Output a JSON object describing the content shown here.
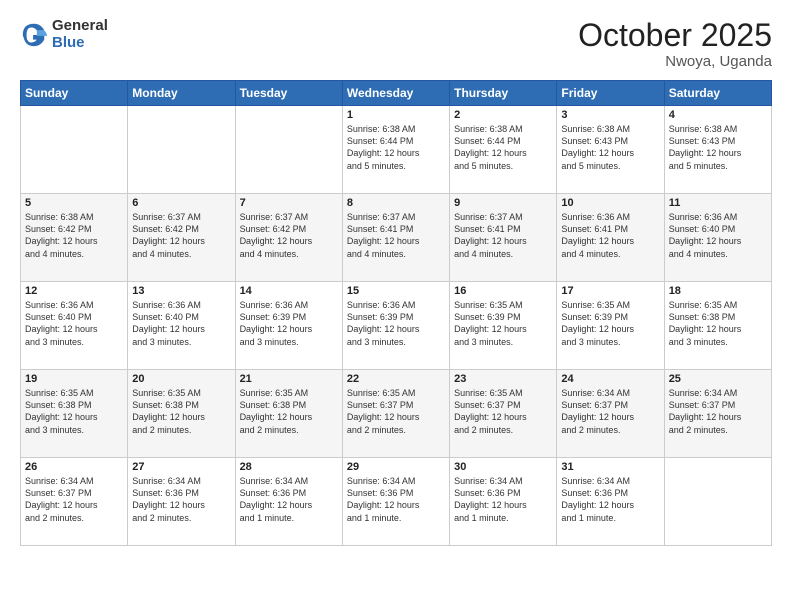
{
  "logo": {
    "general": "General",
    "blue": "Blue"
  },
  "header": {
    "month": "October 2025",
    "location": "Nwoya, Uganda"
  },
  "days_of_week": [
    "Sunday",
    "Monday",
    "Tuesday",
    "Wednesday",
    "Thursday",
    "Friday",
    "Saturday"
  ],
  "weeks": [
    [
      {
        "day": "",
        "info": ""
      },
      {
        "day": "",
        "info": ""
      },
      {
        "day": "",
        "info": ""
      },
      {
        "day": "1",
        "info": "Sunrise: 6:38 AM\nSunset: 6:44 PM\nDaylight: 12 hours\nand 5 minutes."
      },
      {
        "day": "2",
        "info": "Sunrise: 6:38 AM\nSunset: 6:44 PM\nDaylight: 12 hours\nand 5 minutes."
      },
      {
        "day": "3",
        "info": "Sunrise: 6:38 AM\nSunset: 6:43 PM\nDaylight: 12 hours\nand 5 minutes."
      },
      {
        "day": "4",
        "info": "Sunrise: 6:38 AM\nSunset: 6:43 PM\nDaylight: 12 hours\nand 5 minutes."
      }
    ],
    [
      {
        "day": "5",
        "info": "Sunrise: 6:38 AM\nSunset: 6:42 PM\nDaylight: 12 hours\nand 4 minutes."
      },
      {
        "day": "6",
        "info": "Sunrise: 6:37 AM\nSunset: 6:42 PM\nDaylight: 12 hours\nand 4 minutes."
      },
      {
        "day": "7",
        "info": "Sunrise: 6:37 AM\nSunset: 6:42 PM\nDaylight: 12 hours\nand 4 minutes."
      },
      {
        "day": "8",
        "info": "Sunrise: 6:37 AM\nSunset: 6:41 PM\nDaylight: 12 hours\nand 4 minutes."
      },
      {
        "day": "9",
        "info": "Sunrise: 6:37 AM\nSunset: 6:41 PM\nDaylight: 12 hours\nand 4 minutes."
      },
      {
        "day": "10",
        "info": "Sunrise: 6:36 AM\nSunset: 6:41 PM\nDaylight: 12 hours\nand 4 minutes."
      },
      {
        "day": "11",
        "info": "Sunrise: 6:36 AM\nSunset: 6:40 PM\nDaylight: 12 hours\nand 4 minutes."
      }
    ],
    [
      {
        "day": "12",
        "info": "Sunrise: 6:36 AM\nSunset: 6:40 PM\nDaylight: 12 hours\nand 3 minutes."
      },
      {
        "day": "13",
        "info": "Sunrise: 6:36 AM\nSunset: 6:40 PM\nDaylight: 12 hours\nand 3 minutes."
      },
      {
        "day": "14",
        "info": "Sunrise: 6:36 AM\nSunset: 6:39 PM\nDaylight: 12 hours\nand 3 minutes."
      },
      {
        "day": "15",
        "info": "Sunrise: 6:36 AM\nSunset: 6:39 PM\nDaylight: 12 hours\nand 3 minutes."
      },
      {
        "day": "16",
        "info": "Sunrise: 6:35 AM\nSunset: 6:39 PM\nDaylight: 12 hours\nand 3 minutes."
      },
      {
        "day": "17",
        "info": "Sunrise: 6:35 AM\nSunset: 6:39 PM\nDaylight: 12 hours\nand 3 minutes."
      },
      {
        "day": "18",
        "info": "Sunrise: 6:35 AM\nSunset: 6:38 PM\nDaylight: 12 hours\nand 3 minutes."
      }
    ],
    [
      {
        "day": "19",
        "info": "Sunrise: 6:35 AM\nSunset: 6:38 PM\nDaylight: 12 hours\nand 3 minutes."
      },
      {
        "day": "20",
        "info": "Sunrise: 6:35 AM\nSunset: 6:38 PM\nDaylight: 12 hours\nand 2 minutes."
      },
      {
        "day": "21",
        "info": "Sunrise: 6:35 AM\nSunset: 6:38 PM\nDaylight: 12 hours\nand 2 minutes."
      },
      {
        "day": "22",
        "info": "Sunrise: 6:35 AM\nSunset: 6:37 PM\nDaylight: 12 hours\nand 2 minutes."
      },
      {
        "day": "23",
        "info": "Sunrise: 6:35 AM\nSunset: 6:37 PM\nDaylight: 12 hours\nand 2 minutes."
      },
      {
        "day": "24",
        "info": "Sunrise: 6:34 AM\nSunset: 6:37 PM\nDaylight: 12 hours\nand 2 minutes."
      },
      {
        "day": "25",
        "info": "Sunrise: 6:34 AM\nSunset: 6:37 PM\nDaylight: 12 hours\nand 2 minutes."
      }
    ],
    [
      {
        "day": "26",
        "info": "Sunrise: 6:34 AM\nSunset: 6:37 PM\nDaylight: 12 hours\nand 2 minutes."
      },
      {
        "day": "27",
        "info": "Sunrise: 6:34 AM\nSunset: 6:36 PM\nDaylight: 12 hours\nand 2 minutes."
      },
      {
        "day": "28",
        "info": "Sunrise: 6:34 AM\nSunset: 6:36 PM\nDaylight: 12 hours\nand 1 minute."
      },
      {
        "day": "29",
        "info": "Sunrise: 6:34 AM\nSunset: 6:36 PM\nDaylight: 12 hours\nand 1 minute."
      },
      {
        "day": "30",
        "info": "Sunrise: 6:34 AM\nSunset: 6:36 PM\nDaylight: 12 hours\nand 1 minute."
      },
      {
        "day": "31",
        "info": "Sunrise: 6:34 AM\nSunset: 6:36 PM\nDaylight: 12 hours\nand 1 minute."
      },
      {
        "day": "",
        "info": ""
      }
    ]
  ]
}
